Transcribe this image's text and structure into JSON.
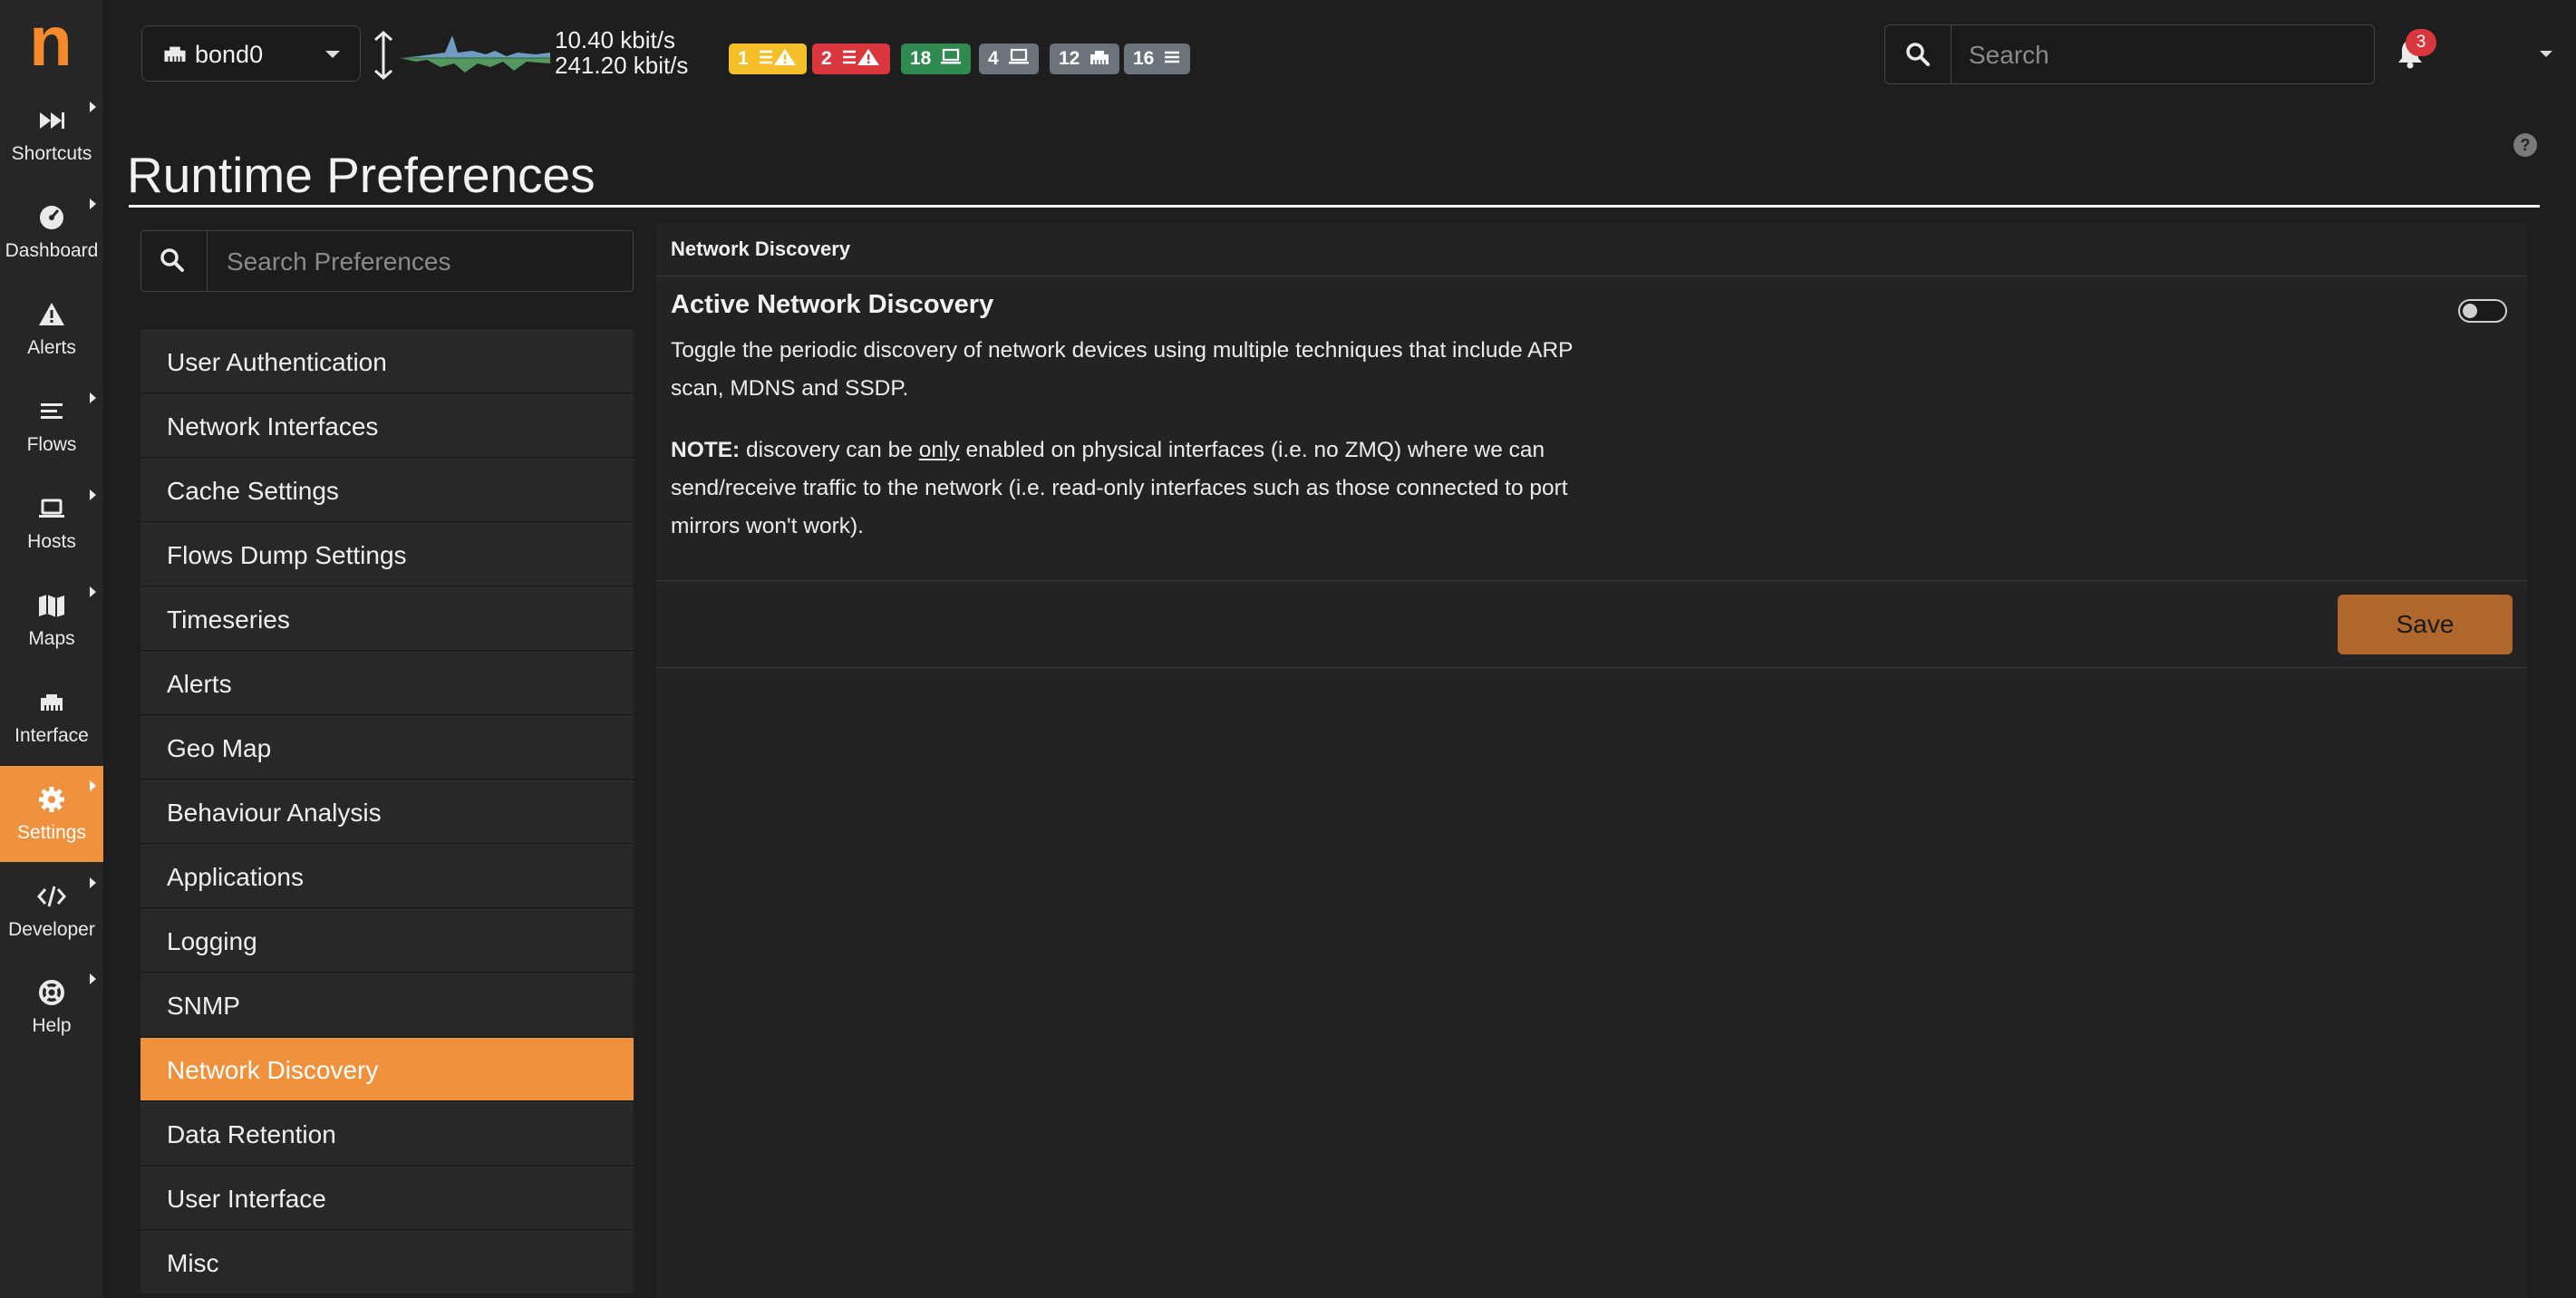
{
  "app": {
    "logo_text": "n"
  },
  "sidenav": {
    "items": [
      {
        "label": "Shortcuts",
        "icon": "fast-forward-icon",
        "caret": true
      },
      {
        "label": "Dashboard",
        "icon": "gauge-icon",
        "caret": true
      },
      {
        "label": "Alerts",
        "icon": "warning-icon",
        "caret": false
      },
      {
        "label": "Flows",
        "icon": "stream-icon",
        "caret": true
      },
      {
        "label": "Hosts",
        "icon": "laptop-icon",
        "caret": true
      },
      {
        "label": "Maps",
        "icon": "map-icon",
        "caret": true
      },
      {
        "label": "Interface",
        "icon": "ethernet-icon",
        "caret": false
      },
      {
        "label": "Settings",
        "icon": "cog-icon",
        "caret": true,
        "active": true
      },
      {
        "label": "Developer",
        "icon": "code-icon",
        "caret": true
      },
      {
        "label": "Help",
        "icon": "lifering-icon",
        "caret": true
      }
    ],
    "active_color": "#f0923d"
  },
  "topbar": {
    "interface": "bond0",
    "rate_up": "10.40 kbit/s",
    "rate_down": "241.20 kbit/s",
    "badges": [
      {
        "text": "1",
        "icon": "list-warning-icon",
        "color": "#f5bf2a",
        "text_color": "#fff"
      },
      {
        "text": "2",
        "icon": "list-warning-icon",
        "color": "#d9363e",
        "text_color": "#fff"
      },
      {
        "text": "18",
        "icon": "laptop-icon",
        "color": "#2f8a4f",
        "text_color": "#fff"
      },
      {
        "text": "4",
        "icon": "laptop-icon",
        "color": "#6c737b",
        "text_color": "#fff"
      },
      {
        "text": "12",
        "icon": "ethernet-icon",
        "color": "#6c737b",
        "text_color": "#fff"
      },
      {
        "text": "16",
        "icon": "list-icon",
        "color": "#6c737b",
        "text_color": "#fff"
      }
    ],
    "search_placeholder": "Search",
    "notifications_count": "3"
  },
  "page": {
    "title": "Runtime Preferences"
  },
  "preferences": {
    "search_placeholder": "Search Preferences",
    "items": [
      {
        "label": "User Authentication"
      },
      {
        "label": "Network Interfaces"
      },
      {
        "label": "Cache Settings"
      },
      {
        "label": "Flows Dump Settings"
      },
      {
        "label": "Timeseries"
      },
      {
        "label": "Alerts"
      },
      {
        "label": "Geo Map"
      },
      {
        "label": "Behaviour Analysis"
      },
      {
        "label": "Applications"
      },
      {
        "label": "Logging"
      },
      {
        "label": "SNMP"
      },
      {
        "label": "Network Discovery",
        "active": true
      },
      {
        "label": "Data Retention"
      },
      {
        "label": "User Interface"
      },
      {
        "label": "Misc"
      }
    ]
  },
  "panel": {
    "header": "Network Discovery",
    "setting_title": "Active Network Discovery",
    "setting_desc": "Toggle the periodic discovery of network devices using multiple techniques that include ARP scan, MDNS and SSDP.",
    "note_label": "NOTE:",
    "note_pre": " discovery can be ",
    "note_emph": "only",
    "note_post": " enabled on physical interfaces (i.e. no ZMQ) where we can send/receive traffic to the network (i.e. read-only interfaces such as those connected to port mirrors won't work).",
    "toggle_on": false,
    "save_label": "Save",
    "save_color": "#b0672c"
  }
}
